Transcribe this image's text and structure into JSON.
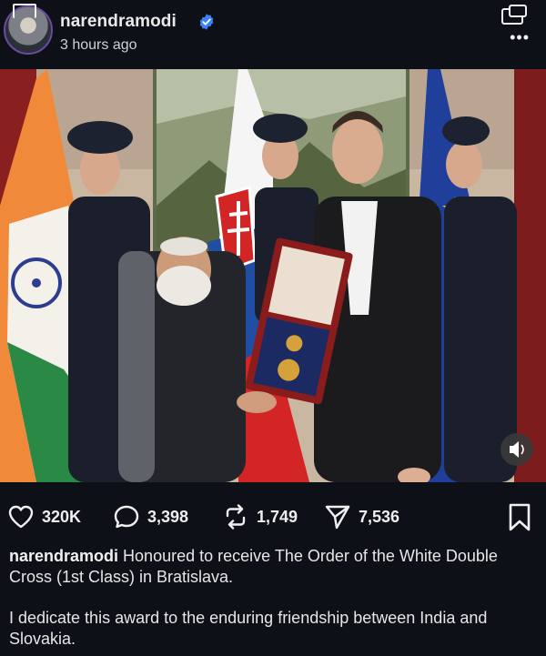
{
  "header": {
    "username": "narendramodi",
    "timestamp": "3 hours ago",
    "verified_icon": "verified-badge-icon",
    "more_label": "•••",
    "colors": {
      "background": "#0d1117",
      "verified": "#3b82f6"
    }
  },
  "post": {
    "media_type": "photo"
  },
  "actions": {
    "likes": "320K",
    "comments": "3,398",
    "reposts": "1,749",
    "shares": "7,536",
    "icons": [
      "heart-icon",
      "comment-icon",
      "repost-icon",
      "share-icon",
      "bookmark-icon"
    ]
  },
  "caption": {
    "username": "narendramodi",
    "text": "Honoured to receive The Order of the White Double Cross (1st Class) in Bratislava.",
    "paragraph2": "I dedicate this award to the enduring friendship between India and Slovakia."
  }
}
